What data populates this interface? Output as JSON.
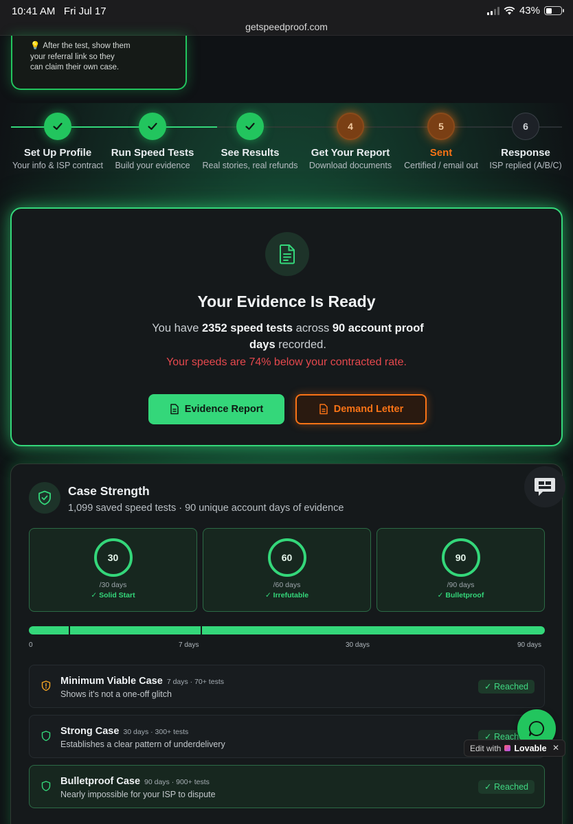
{
  "status_bar": {
    "time": "10:41 AM",
    "date": "Fri Jul 17",
    "battery": "43%",
    "battery_level": 0.43
  },
  "browser": {
    "url": "getspeedproof.com"
  },
  "tip": {
    "icon": "lightbulb-icon",
    "lines": [
      "After the test, show them",
      "your referral link so they",
      "can claim their own case."
    ]
  },
  "stepper": {
    "steps": [
      {
        "number": "1",
        "title": "Set Up Profile",
        "sub": "Your info & ISP contract",
        "state": "done"
      },
      {
        "number": "2",
        "title": "Run Speed Tests",
        "sub": "Build your evidence",
        "state": "done"
      },
      {
        "number": "3",
        "title": "See Results",
        "sub": "Real stories, real refunds",
        "state": "done"
      },
      {
        "number": "4",
        "title": "Get Your Report",
        "sub": "Download documents",
        "state": "active"
      },
      {
        "number": "5",
        "title": "Sent",
        "sub": "Certified / email out",
        "state": "active"
      },
      {
        "number": "6",
        "title": "Response",
        "sub": "ISP replied (A/B/C)",
        "state": "pending"
      }
    ]
  },
  "evidence": {
    "title": "Your Evidence Is Ready",
    "desc_prefix": "You have ",
    "tests": "2352 speed tests",
    "desc_mid": " across ",
    "days": "90 account proof days",
    "desc_suffix": " recorded.",
    "warning": "Your speeds are 74% below your contracted rate.",
    "report_button": "Evidence Report",
    "letter_button": "Demand Letter"
  },
  "case_strength": {
    "title": "Case Strength",
    "subtitle": "1,099 saved speed tests · 90 unique account days of evidence",
    "milestones": [
      {
        "value": "30",
        "days": "/30 days",
        "label": "✓ Solid Start"
      },
      {
        "value": "60",
        "days": "/60 days",
        "label": "✓ Irrefutable"
      },
      {
        "value": "90",
        "days": "/90 days",
        "label": "✓ Bulletproof"
      }
    ],
    "progress": {
      "fraction": 1.0,
      "labels": [
        "0",
        "7 days",
        "30 days",
        "90 days"
      ]
    },
    "levels": [
      {
        "name": "Minimum Viable Case",
        "meta": "7 days · 70+ tests",
        "desc": "Shows it's not a one-off glitch",
        "status": "✓ Reached",
        "icon": "shield-alert-icon"
      },
      {
        "name": "Strong Case",
        "meta": "30 days · 300+ tests",
        "desc": "Establishes a clear pattern of underdelivery",
        "status": "✓ Reached",
        "icon": "shield-icon"
      },
      {
        "name": "Bulletproof Case",
        "meta": "90 days · 900+ tests",
        "desc": "Nearly impossible for your ISP to dispute",
        "status": "✓ Reached",
        "icon": "shield-icon"
      }
    ]
  },
  "overlay": {
    "edit_with": "Edit with",
    "brand": "Lovable",
    "close": "✕"
  },
  "colors": {
    "accent_green": "#34d77a",
    "accent_orange": "#f97316",
    "warning_red": "#e5484d",
    "background": "#0f1215"
  }
}
